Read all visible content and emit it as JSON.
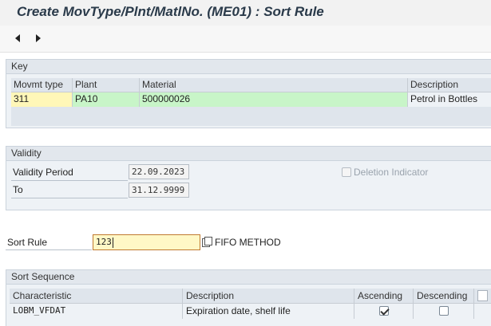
{
  "window": {
    "title": "Create MovType/Plnt/MatlNo. (ME01) : Sort Rule"
  },
  "toolbar": {
    "back_icon": "triangle-left-icon",
    "forward_icon": "triangle-right-icon"
  },
  "key": {
    "title": "Key",
    "columns": [
      "Movmt type",
      "Plant",
      "Material",
      "Description"
    ],
    "row": {
      "movmt_type": "311",
      "plant": "PA10",
      "material": "500000026",
      "description": "Petrol in Bottles"
    }
  },
  "validity": {
    "title": "Validity",
    "period_label": "Validity Period",
    "period_value": "22.09.2023",
    "to_label": "To",
    "to_value": "31.12.9999",
    "deletion_label": "Deletion Indicator",
    "deletion_checked": false
  },
  "sort_rule": {
    "label": "Sort Rule",
    "value": "123",
    "description": "FIFO METHOD"
  },
  "sort_sequence": {
    "title": "Sort Sequence",
    "columns": [
      "Characteristic",
      "Description",
      "Ascending",
      "Descending"
    ],
    "rows": [
      {
        "characteristic": "LOBM_VFDAT",
        "description": "Expiration date, shelf life",
        "ascending": true,
        "descending": false
      }
    ]
  },
  "colors": {
    "key_highlight": "#fff7b8",
    "key_green": "#c8f5c8",
    "panel": "#eef2f6"
  }
}
